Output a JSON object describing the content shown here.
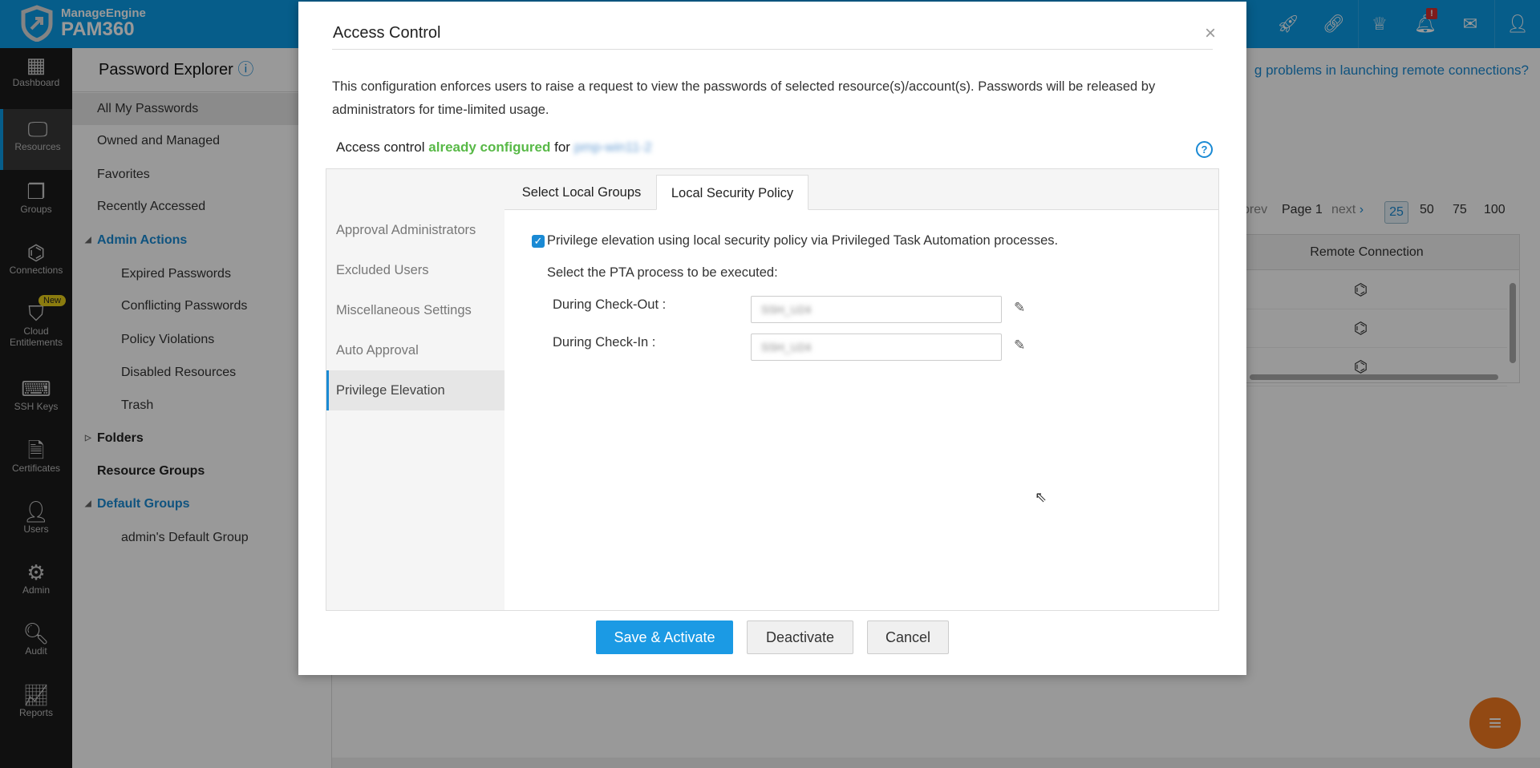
{
  "header": {
    "brand_top": "ManageEngine",
    "brand_bottom": "PAM360",
    "icons": [
      "rocket-icon",
      "link-icon",
      "crown-icon",
      "bell-icon",
      "mail-icon",
      "user-icon"
    ],
    "bell_badge": "!",
    "color": "#0a9be6"
  },
  "leftnav": [
    {
      "label": "Dashboard",
      "icon": "dashboard-icon"
    },
    {
      "label": "Resources",
      "icon": "monitor-icon",
      "selected": true
    },
    {
      "label": "Groups",
      "icon": "groups-icon"
    },
    {
      "label": "Connections",
      "icon": "connections-icon"
    },
    {
      "label": "Cloud Entitlements",
      "icon": "cloud-shield-icon",
      "badge": "New"
    },
    {
      "label": "SSH Keys",
      "icon": "ssh-icon"
    },
    {
      "label": "Certificates",
      "icon": "certificate-icon"
    },
    {
      "label": "Users",
      "icon": "user-icon"
    },
    {
      "label": "Admin",
      "icon": "gear-icon"
    },
    {
      "label": "Audit",
      "icon": "audit-icon"
    },
    {
      "label": "Reports",
      "icon": "reports-icon"
    }
  ],
  "panel": {
    "title": "Password Explorer",
    "items": [
      "All My Passwords",
      "Owned and Managed",
      "Favorites",
      "Recently Accessed",
      "Admin Actions",
      "Expired Passwords",
      "Conflicting Passwords",
      "Policy Violations",
      "Disabled Resources",
      "Trash",
      "Folders",
      "Resource Groups",
      "Default Groups",
      "admin's Default Group"
    ]
  },
  "main": {
    "link": "g problems in launching remote connections?",
    "pagination": {
      "prev": "prev",
      "page": "Page 1",
      "next": "next",
      "sizes": [
        "25",
        "50",
        "75",
        "100"
      ],
      "selected": "25"
    },
    "table": {
      "header": "Remote Connection",
      "rows": 3
    }
  },
  "modal": {
    "title": "Access Control",
    "close": "×",
    "description": "This configuration enforces users to raise a request to view the passwords of selected resource(s)/account(s). Passwords will be released by administrators for time-limited usage.",
    "ac_prefix": "Access control",
    "ac_status": "already configured",
    "ac_for": "for",
    "ac_resource": "pmp-win11-2",
    "side": [
      "Approval Administrators",
      "Excluded Users",
      "Miscellaneous Settings",
      "Auto Approval",
      "Privilege Elevation"
    ],
    "side_selected": "Privilege Elevation",
    "tabs": [
      "Select Local Groups",
      "Local Security Policy"
    ],
    "active_tab": "Local Security Policy",
    "checkbox_label": "Privilege elevation using local security policy via Privileged Task Automation processes.",
    "checkbox_checked": true,
    "select_label": "Select the PTA process to be executed:",
    "checkout_label": "During Check-Out :",
    "checkout_value": "SSH_U24",
    "checkin_label": "During Check-In :",
    "checkin_value": "SSH_U24",
    "buttons": {
      "save": "Save & Activate",
      "deactivate": "Deactivate",
      "cancel": "Cancel"
    }
  }
}
